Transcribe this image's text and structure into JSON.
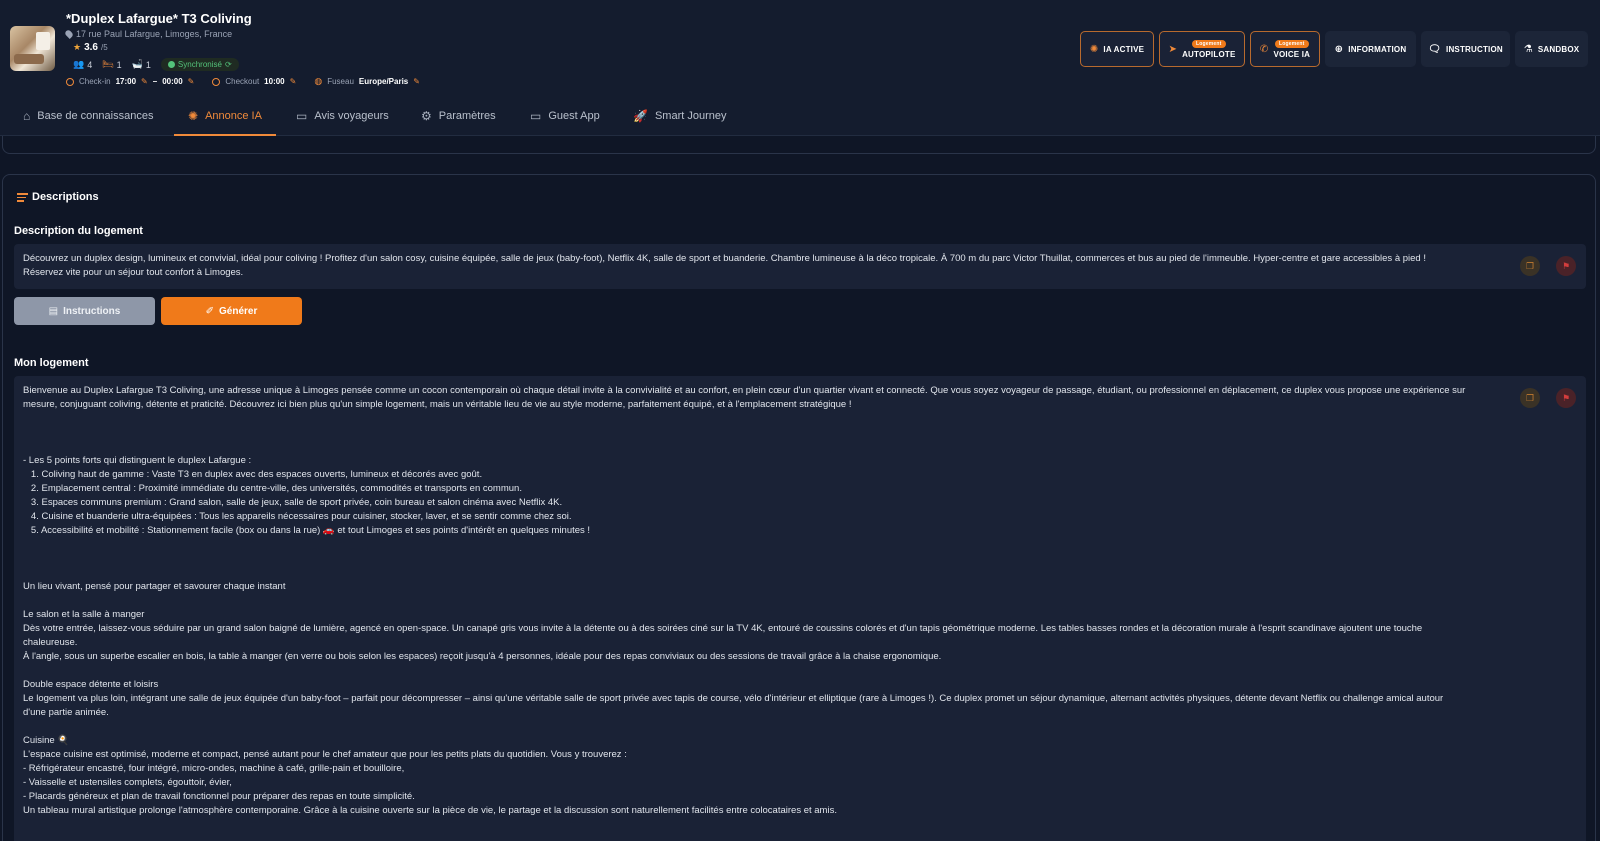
{
  "header": {
    "title": "*Duplex Lafargue* T3 Coliving",
    "address": "17 rue Paul Lafargue, Limoges, France",
    "rating": "3.6",
    "rating_max": "/5",
    "guests": "4",
    "bedrooms": "1",
    "bathrooms": "1",
    "sync_status": "Synchronisé",
    "checkin_label": "Check-in",
    "checkin_from": "17:00",
    "checkin_sep": "–",
    "checkin_to": "00:00",
    "checkout_label": "Checkout",
    "checkout_time": "10:00",
    "timezone_label": "Fuseau",
    "timezone": "Europe/Paris"
  },
  "actions": {
    "ia_active": "IA ACTIVE",
    "autopilote_tag": "Logement",
    "autopilote": "AUTOPILOTE",
    "voice_tag": "Logement",
    "voice": "VOICE IA",
    "information": "INFORMATION",
    "instruction": "INSTRUCTION",
    "sandbox": "SANDBOX"
  },
  "tabs": [
    {
      "label": "Base de connaissances"
    },
    {
      "label": "Annonce IA"
    },
    {
      "label": "Avis voyageurs"
    },
    {
      "label": "Paramètres"
    },
    {
      "label": "Guest App"
    },
    {
      "label": "Smart Journey"
    }
  ],
  "descriptions": {
    "section_title": "Descriptions",
    "description_label": "Description du logement",
    "description_text": "Découvrez un duplex design, lumineux et convivial, idéal pour coliving ! Profitez d'un salon cosy, cuisine équipée, salle de jeux (baby-foot), Netflix 4K, salle de sport et buanderie. Chambre lumineuse à la déco tropicale. À 700 m du parc Victor Thuillat, commerces et bus au pied de l'immeuble. Hyper-centre et gare accessibles à pied !\nRéservez vite pour un séjour tout confort à Limoges.",
    "instructions_button": "Instructions",
    "generate_button": "Générer",
    "mon_logement_label": "Mon logement",
    "mon_logement_text": "Bienvenue au Duplex Lafargue T3 Coliving, une adresse unique à Limoges pensée comme un cocon contemporain où chaque détail invite à la convivialité et au confort, en plein cœur d'un quartier vivant et connecté. Que vous soyez voyageur de passage, étudiant, ou professionnel en déplacement, ce duplex vous propose une expérience sur\nmesure, conjuguant coliving, détente et praticité. Découvrez ici bien plus qu'un simple logement, mais un véritable lieu de vie au style moderne, parfaitement équipé, et à l'emplacement stratégique !\n\n\n\n- Les 5 points forts qui distinguent le duplex Lafargue :\n   1. Coliving haut de gamme : Vaste T3 en duplex avec des espaces ouverts, lumineux et décorés avec goût.\n   2. Emplacement central : Proximité immédiate du centre-ville, des universités, commodités et transports en commun.\n   3. Espaces communs premium : Grand salon, salle de jeux, salle de sport privée, coin bureau et salon cinéma avec Netflix 4K.\n   4. Cuisine et buanderie ultra-équipées : Tous les appareils nécessaires pour cuisiner, stocker, laver, et se sentir comme chez soi.\n   5. Accessibilité et mobilité : Stationnement facile (box ou dans la rue) 🚗 et tout Limoges et ses points d'intérêt en quelques minutes !\n\n\n\nUn lieu vivant, pensé pour partager et savourer chaque instant\n\nLe salon et la salle à manger\nDès votre entrée, laissez-vous séduire par un grand salon baigné de lumière, agencé en open-space. Un canapé gris vous invite à la détente ou à des soirées ciné sur la TV 4K, entouré de coussins colorés et d'un tapis géométrique moderne. Les tables basses rondes et la décoration murale à l'esprit scandinave ajoutent une touche\nchaleureuse.\nÀ l'angle, sous un superbe escalier en bois, la table à manger (en verre ou bois selon les espaces) reçoit jusqu'à 4 personnes, idéale pour des repas conviviaux ou des sessions de travail grâce à la chaise ergonomique.\n\nDouble espace détente et loisirs\nLe logement va plus loin, intégrant une salle de jeux équipée d'un baby-foot – parfait pour décompresser – ainsi qu'une véritable salle de sport privée avec tapis de course, vélo d'intérieur et elliptique (rare à Limoges !). Ce duplex promet un séjour dynamique, alternant activités physiques, détente devant Netflix ou challenge amical autour\nd'une partie animée.\n\nCuisine 🍳\nL'espace cuisine est optimisé, moderne et compact, pensé autant pour le chef amateur que pour les petits plats du quotidien. Vous y trouverez :\n- Réfrigérateur encastré, four intégré, micro-ondes, machine à café, grille-pain et bouilloire,\n- Vaisselle et ustensiles complets, égouttoir, évier,\n- Placards généreux et plan de travail fonctionnel pour préparer des repas en toute simplicité.\nUn tableau mural artistique prolonge l'atmosphère contemporaine. Grâce à la cuisine ouverte sur la pièce de vie, le partage et la discussion sont naturellement facilités entre colocataires et amis."
  },
  "colors": {
    "accent": "#f07a1a",
    "background": "#0f1626",
    "panel": "#1a2236",
    "success": "#53c27a",
    "danger": "#d33d3d"
  },
  "icons": {
    "pin": "map-pin-icon",
    "star": "star-icon",
    "guests": "users-icon",
    "bed": "bed-icon",
    "bath": "bath-icon",
    "clock": "clock-icon",
    "globe": "globe-icon",
    "edit": "pencil-icon",
    "copy": "copy-icon",
    "flag": "flag-icon"
  }
}
